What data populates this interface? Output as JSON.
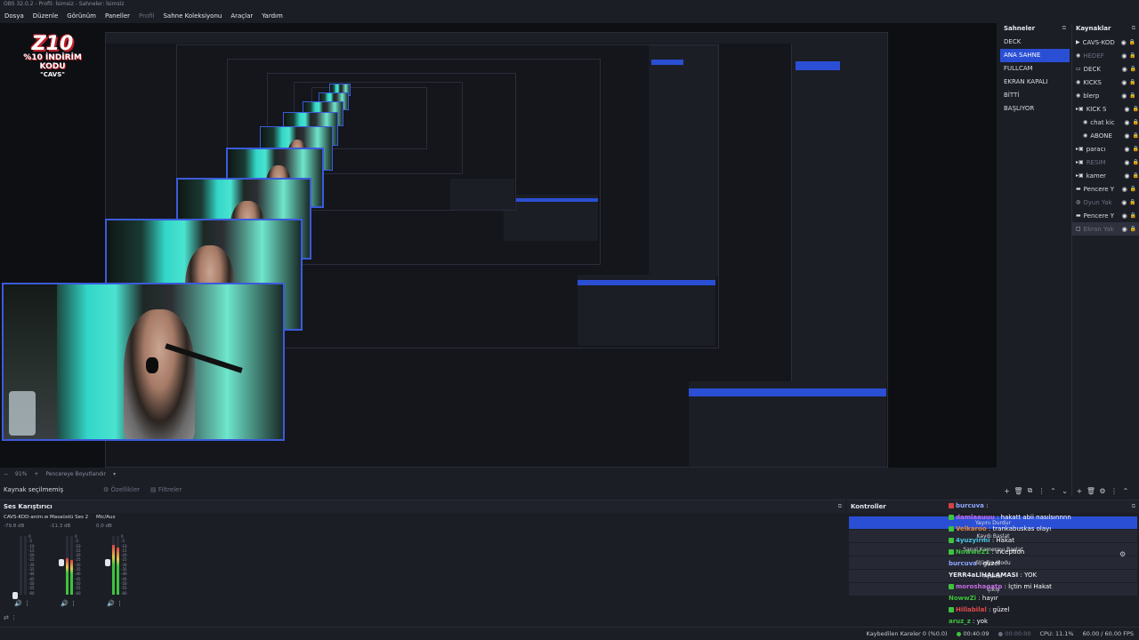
{
  "window": {
    "title": "OBS 32.0.2 - Profil: İsimsiz - Sahneler: İsimsiz"
  },
  "menu": {
    "items": [
      "Dosya",
      "Düzenle",
      "Görünüm",
      "Paneller",
      "Profil",
      "Sahne Koleksiyonu",
      "Araçlar",
      "Yardım"
    ]
  },
  "logo": {
    "big": "Z10",
    "sub": "%10 İNDİRİM KODU",
    "code": "\"CAVS\""
  },
  "scenes": {
    "title": "Sahneler",
    "items": [
      {
        "label": "DECK",
        "active": false
      },
      {
        "label": "ANA SAHNE",
        "active": true
      },
      {
        "label": "FULLCAM",
        "active": false
      },
      {
        "label": "EKRAN KAPALI",
        "active": false
      },
      {
        "label": "BİTTİ",
        "active": false
      },
      {
        "label": "BAŞLIYOR",
        "active": false
      }
    ]
  },
  "sources": {
    "title": "Kaynaklar",
    "items": [
      {
        "label": "CAVS-KOD",
        "icon": "play-icon",
        "dim": false,
        "indent": 0
      },
      {
        "label": "HEDEF",
        "icon": "globe-icon",
        "dim": true,
        "indent": 0
      },
      {
        "label": "DECK",
        "icon": "screen-icon",
        "dim": false,
        "indent": 0
      },
      {
        "label": "KİCKS",
        "icon": "globe-icon",
        "dim": false,
        "indent": 0
      },
      {
        "label": "blerp",
        "icon": "globe-icon",
        "dim": false,
        "indent": 0
      },
      {
        "label": "KİCK S",
        "icon": "folder-icon",
        "dim": false,
        "indent": 0
      },
      {
        "label": "chat kic",
        "icon": "globe-icon",
        "dim": false,
        "indent": 1
      },
      {
        "label": "ABONE",
        "icon": "globe-icon",
        "dim": false,
        "indent": 1
      },
      {
        "label": "paracı",
        "icon": "folder-icon",
        "dim": false,
        "indent": 0
      },
      {
        "label": "RESİM",
        "icon": "folder-icon",
        "dim": true,
        "indent": 0
      },
      {
        "label": "kamer",
        "icon": "folder-icon",
        "dim": false,
        "indent": 0
      },
      {
        "label": "Pencere Y",
        "icon": "window-icon",
        "dim": false,
        "indent": 0
      },
      {
        "label": "Oyun Yak",
        "icon": "gamepad-icon",
        "dim": true,
        "indent": 0
      },
      {
        "label": "Pencere Y",
        "icon": "window-icon",
        "dim": false,
        "indent": 0
      },
      {
        "label": "Ekran Yak",
        "icon": "monitor-icon",
        "dim": true,
        "indent": 0,
        "selected": true
      }
    ]
  },
  "preview_bar": {
    "zoom": "91%",
    "fit_label": "Pencereye Boyutlandır"
  },
  "source_toolbar": {
    "no_source": "Kaynak seçilmemiş",
    "properties": "Özellikler",
    "filters": "Filtreler"
  },
  "mixer": {
    "title": "Ses Karıştırıcı",
    "channels": [
      {
        "name": "CAVS-KOD-anim.w",
        "db": "-79.8 dB",
        "level": 0.0
      },
      {
        "name": "Masaüstü Ses 2",
        "db": "-11.3 dB",
        "level": 0.62
      },
      {
        "name": "Mic/Aux",
        "db": "0.0 dB",
        "level": 0.85
      }
    ],
    "scale": [
      "0",
      "-5",
      "-10",
      "-15",
      "-20",
      "-25",
      "-30",
      "-35",
      "-40",
      "-45",
      "-50",
      "-55",
      "-60"
    ]
  },
  "controls": {
    "title": "Kontroller",
    "overlay_lines": [
      "Yayını Durdur",
      "Kaydı Başlat",
      "Sanal Kamerayı Başlat",
      "Stüdyo Modu",
      "Ayarlar",
      "Çıkış"
    ]
  },
  "chat": {
    "lines": [
      {
        "user": "burcuva",
        "msg": "",
        "color": "#8fa8ff",
        "badge": "#d94040"
      },
      {
        "user": "damlaauuu",
        "msg": "hakatt abii nasılsınnnn",
        "color": "#c06adf",
        "badge": "#3ec23e"
      },
      {
        "user": "Velkaroo",
        "msg": "trankabuskas olayı",
        "color": "#e08a3c",
        "badge": "#3ec23e"
      },
      {
        "user": "4yuzyirmi",
        "msg": "Hakat",
        "color": "#4ac3e0",
        "badge": "#3ec23e"
      },
      {
        "user": "Nowwe21",
        "msg": "inception",
        "color": "#3ec23e",
        "badge": "#3ec23e"
      },
      {
        "user": "burcuva",
        "msg": "güzel",
        "color": "#8fa8ff",
        "badge": ""
      },
      {
        "user": "YERR4aLlHALAMASI",
        "msg": "YOK",
        "color": "#e4e6ec",
        "badge": ""
      },
      {
        "user": "moroshagatp",
        "msg": "İçtin mi Hakat",
        "color": "#c06adf",
        "badge": "#3ec23e"
      },
      {
        "user": "NowwZi",
        "msg": "hayır",
        "color": "#3ec23e",
        "badge": ""
      },
      {
        "user": "Hillabilal",
        "msg": "güzel",
        "color": "#e04a4a",
        "badge": "#3ec23e"
      },
      {
        "user": "aruz_z",
        "msg": "yok",
        "color": "#3ec23e",
        "badge": ""
      },
      {
        "user": "ahrk",
        "msg": "iyi",
        "color": "#8fa8ff",
        "badge": ""
      }
    ]
  },
  "statusbar": {
    "dropped": "Kaybedilen Kareler 0 (%0.0)",
    "live_time": "00:40:09",
    "rec_time": "00:00:00",
    "cpu": "CPU: 11.1%",
    "fps": "60.00 / 60.00 FPS"
  },
  "colors": {
    "accent": "#2a4fd4",
    "bg": "#1c1e26",
    "panel": "#262833",
    "teal": "#4ae3d0"
  }
}
